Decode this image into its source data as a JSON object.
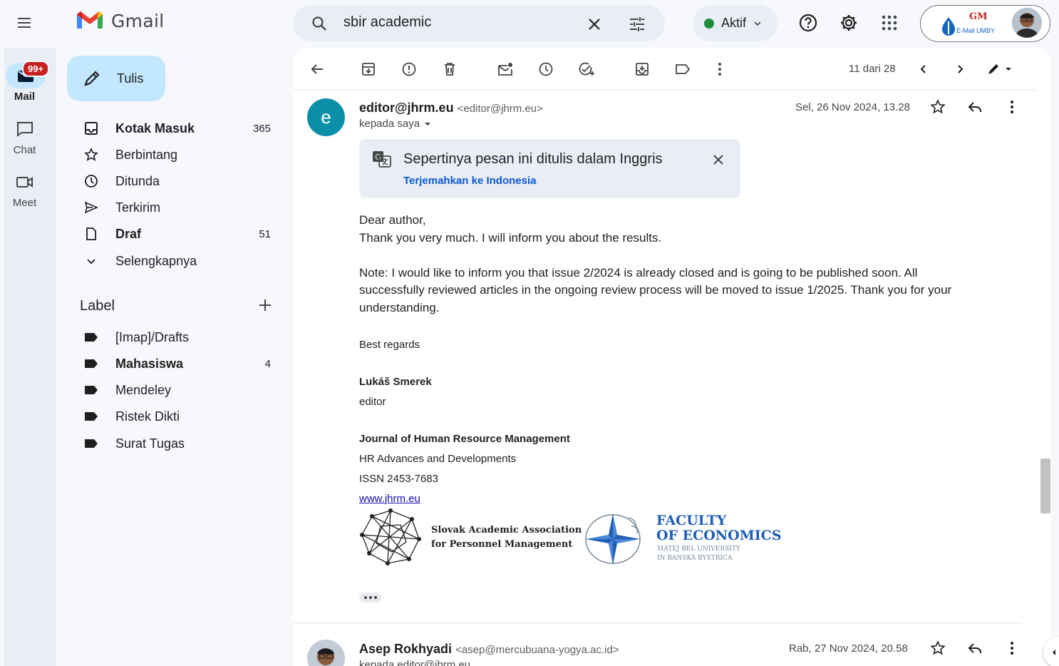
{
  "app": {
    "logo_text": "Gmail"
  },
  "search": {
    "value": "sbir academic"
  },
  "status": {
    "label": "Aktif",
    "color": "#1e8e3e"
  },
  "account": {
    "badge_text": "E-Mail UMBY",
    "logo_letters": "GM"
  },
  "rail": {
    "mail_label": "Mail",
    "mail_badge": "99+",
    "chat_label": "Chat",
    "meet_label": "Meet"
  },
  "compose": {
    "label": "Tulis"
  },
  "nav": {
    "items": [
      {
        "label": "Kotak Masuk",
        "count": "365",
        "icon": "inbox-icon"
      },
      {
        "label": "Berbintang",
        "count": "",
        "icon": "star-icon"
      },
      {
        "label": "Ditunda",
        "count": "",
        "icon": "clock-icon"
      },
      {
        "label": "Terkirim",
        "count": "",
        "icon": "send-icon"
      },
      {
        "label": "Draf",
        "count": "51",
        "icon": "draft-icon"
      },
      {
        "label": "Selengkapnya",
        "count": "",
        "icon": "chevron-down-icon"
      }
    ],
    "label_heading": "Label",
    "labels": [
      {
        "label": "[Imap]/Drafts",
        "count": ""
      },
      {
        "label": "Mahasiswa",
        "count": "4"
      },
      {
        "label": "Mendeley",
        "count": ""
      },
      {
        "label": "Ristek Dikti",
        "count": ""
      },
      {
        "label": "Surat Tugas",
        "count": ""
      }
    ]
  },
  "toolbar": {
    "pager": "11 dari 28"
  },
  "message": {
    "avatar_letter": "e",
    "sender_name": "editor@jhrm.eu",
    "sender_email": "<editor@jhrm.eu>",
    "recipient": "kepada saya",
    "date": "Sel, 26 Nov 2024, 13.28",
    "translate_title": "Sepertinya pesan ini ditulis dalam Inggris",
    "translate_link": "Terjemahkan ke Indonesia",
    "body": [
      "Dear author,",
      "Thank you very much. I will inform you about the results.",
      "Note: I would like to inform you that issue 2/2024 is already closed and is going to be published soon. All",
      "successfully reviewed articles in the ongoing review process will be moved to issue 1/2025. Thank you for your",
      "understanding."
    ],
    "signature": {
      "greeting": "Best regards",
      "name": "Lukáš Smerek",
      "role": "editor",
      "journal": "Journal of Human Resource Management",
      "subtitle": "HR Advances and Developments",
      "issn": "ISSN 2453-7683",
      "url": "www.jhrm.eu",
      "assoc_line1": "Slovak Academic Association",
      "assoc_line2": "for Personnel Management",
      "faculty_line1": "FACULTY",
      "faculty_line2": "OF ECONOMICS",
      "univ_line1": "MATEJ BEL UNIVERSITY",
      "univ_line2": "IN BANSKÁ BYSTRICA"
    }
  },
  "message2": {
    "sender_name": "Asep Rokhyadi",
    "sender_email": "<asep@mercubuana-yogya.ac.id>",
    "date": "Rab, 27 Nov 2024, 20.58",
    "recipient": "kepada editor@jhrm.eu"
  },
  "colors": {
    "accent_blue": "#0b57d0",
    "compose_bg": "#c2e7ff",
    "badge_red": "#c5221f",
    "avatar_teal": "#0b8fa8",
    "faculty_blue": "#1f5fb4"
  }
}
